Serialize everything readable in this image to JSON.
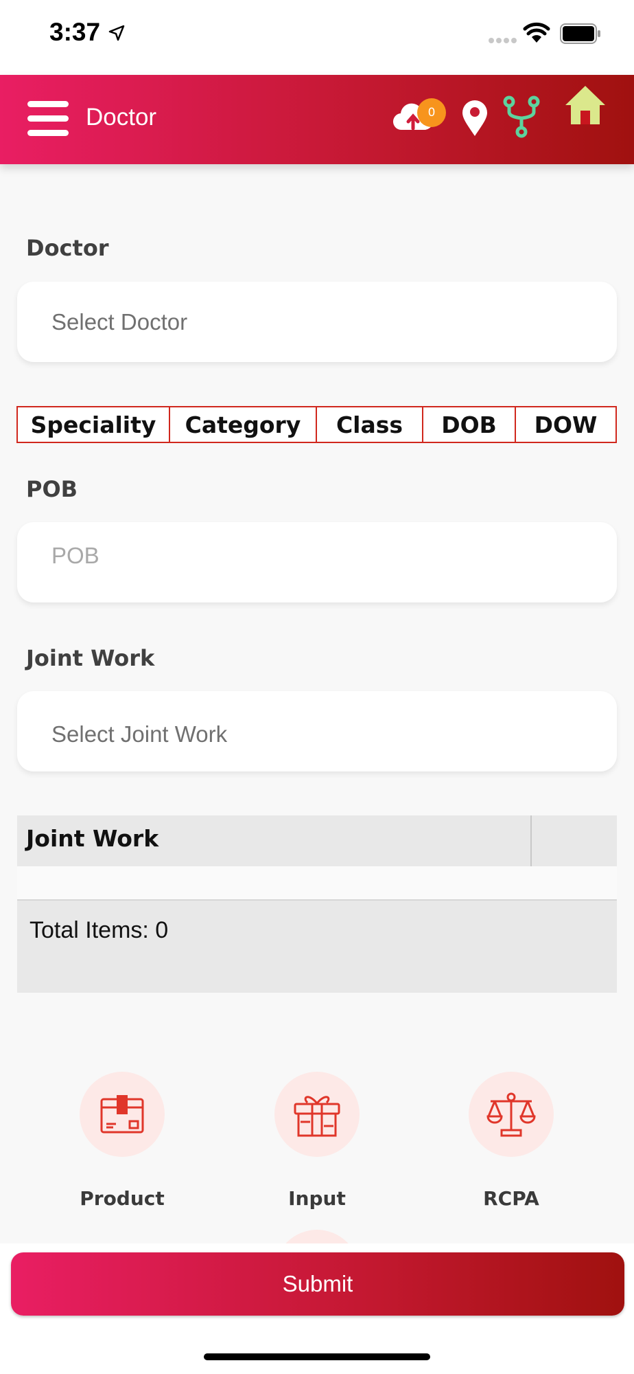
{
  "status_bar": {
    "time": "3:37"
  },
  "header": {
    "title": "Doctor",
    "sync_count": "0"
  },
  "doctor": {
    "label": "Doctor",
    "placeholder": "Select Doctor"
  },
  "info_tabs": [
    "Speciality",
    "Category",
    "Class",
    "DOB",
    "DOW"
  ],
  "pob": {
    "label": "POB",
    "placeholder": "POB"
  },
  "joint_work": {
    "label": "Joint Work",
    "placeholder": "Select Joint Work"
  },
  "joint_work_table": {
    "header": "Joint Work",
    "total": "Total Items: 0"
  },
  "actions": [
    "Product",
    "Input",
    "RCPA"
  ],
  "submit_label": "Submit",
  "colors": {
    "brand_start": "#e91e63",
    "brand_end": "#a0110f",
    "badge": "#f7941d",
    "fork": "#5dd39e",
    "home": "#dbe88c"
  }
}
